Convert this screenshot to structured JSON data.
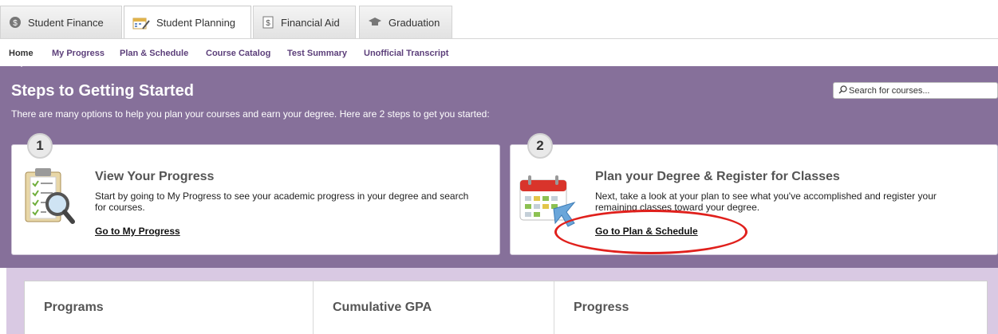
{
  "tabs": [
    {
      "label": "Student Finance",
      "icon": "coin-icon"
    },
    {
      "label": "Student Planning",
      "icon": "calendar-pen-icon",
      "active": true
    },
    {
      "label": "Financial Aid",
      "icon": "dollar-bill-icon"
    },
    {
      "label": "Graduation",
      "icon": "graduation-cap-icon"
    }
  ],
  "subnav": [
    "Home",
    "My Progress",
    "Plan & Schedule",
    "Course Catalog",
    "Test Summary",
    "Unofficial Transcript"
  ],
  "band": {
    "title": "Steps to Getting Started",
    "subtitle": "There are many options to help you plan your courses and earn your degree. Here are 2 steps to get you started:"
  },
  "search": {
    "placeholder": "Search for courses..."
  },
  "steps": [
    {
      "number": "1",
      "title": "View Your Progress",
      "description": "Start by going to My Progress to see your academic progress in your degree and search for courses.",
      "link": "Go to My Progress"
    },
    {
      "number": "2",
      "title": "Plan your Degree & Register for Classes",
      "description": "Next, take a look at your plan to see what you've accomplished and register your remaining classes toward your degree.",
      "link": "Go to Plan & Schedule"
    }
  ],
  "summary": {
    "headers": [
      "Programs",
      "Cumulative GPA",
      "Progress"
    ]
  },
  "colors": {
    "accent_purple": "#86709a",
    "lavender": "#d9c9e3",
    "nav_link": "#5c3f7a",
    "highlight_red": "#e0201c"
  }
}
